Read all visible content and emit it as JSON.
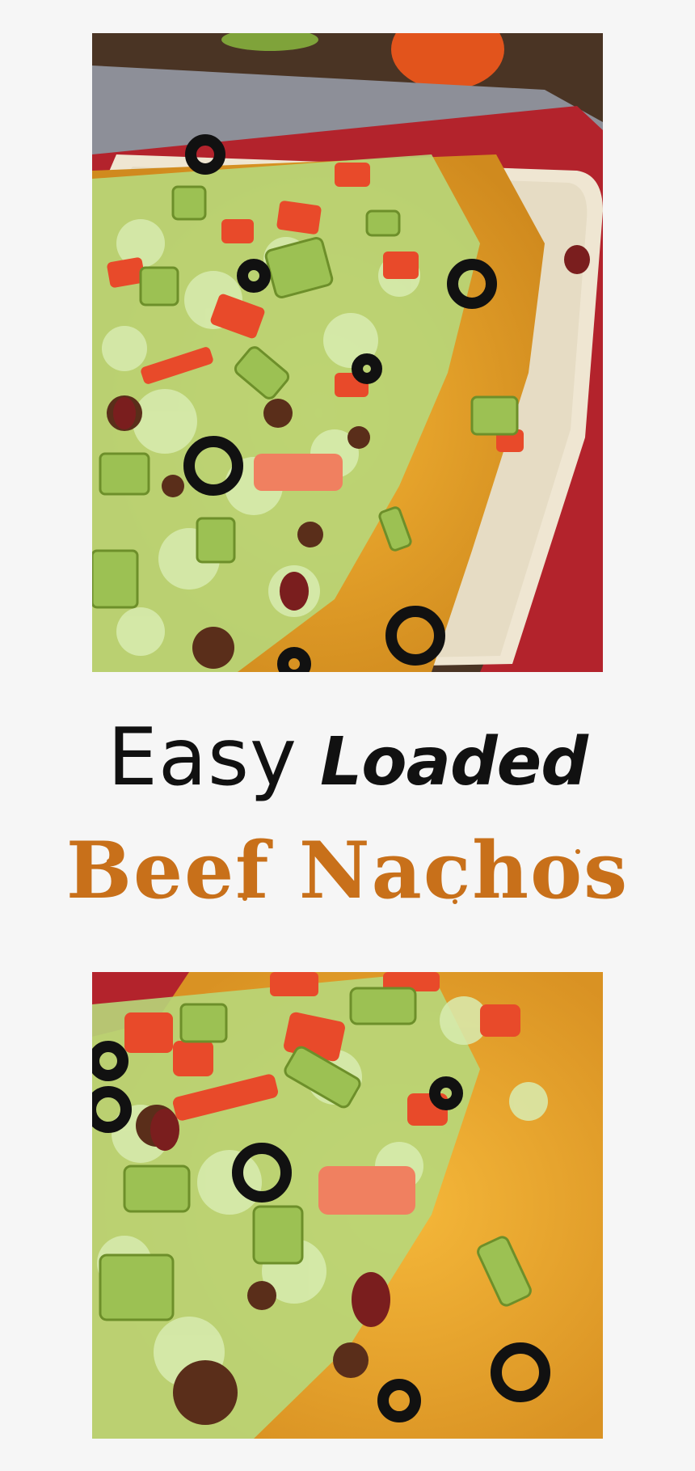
{
  "title": {
    "word1": "Easy",
    "word2": "Loaded",
    "line2": "Beef Nachos"
  },
  "colors": {
    "background": "#f6f6f6",
    "title_dark": "#111111",
    "title_accent": "#c8701a"
  }
}
